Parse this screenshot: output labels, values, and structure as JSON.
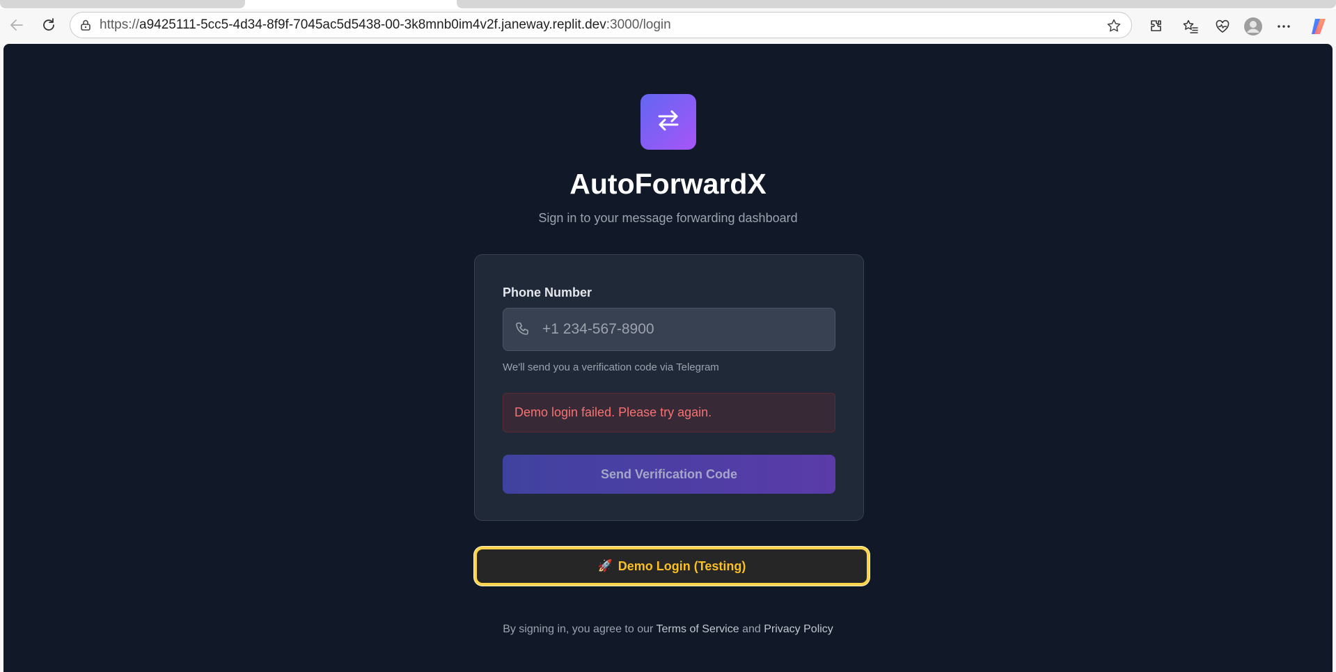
{
  "browser": {
    "url_scheme": "https://",
    "url_host": "a9425111-5cc5-4d34-8f9f-7045ac5d5438-00-3k8mnb0im4v2f.janeway.replit.dev",
    "url_tail": ":3000/login",
    "icons": [
      "back-icon",
      "reload-icon",
      "lock-icon",
      "star-icon",
      "extensions-icon",
      "favorites-icon",
      "health-icon",
      "profile-icon",
      "more-icon",
      "copilot-icon"
    ]
  },
  "login": {
    "app_title": "AutoForwardX",
    "subtitle": "Sign in to your message forwarding dashboard",
    "phone_label": "Phone Number",
    "phone_placeholder": "+1 234-567-8900",
    "phone_value": "",
    "hint": "We'll send you a verification code via Telegram",
    "error": "Demo login failed. Please try again.",
    "send_button": "Send Verification Code",
    "demo_button_icon": "🚀",
    "demo_button": "Demo Login (Testing)",
    "footer_prefix": "By signing in, you agree to our ",
    "terms_link": "Terms of Service",
    "footer_and": " and ",
    "privacy_link": "Privacy Policy"
  },
  "colors": {
    "page_bg": "#111827",
    "card_bg": "#1f2937",
    "accent_start": "#6366f1",
    "accent_end": "#a855f7",
    "error": "#f87171",
    "demo_border": "#fcd34d",
    "demo_text": "#fbbf24"
  }
}
